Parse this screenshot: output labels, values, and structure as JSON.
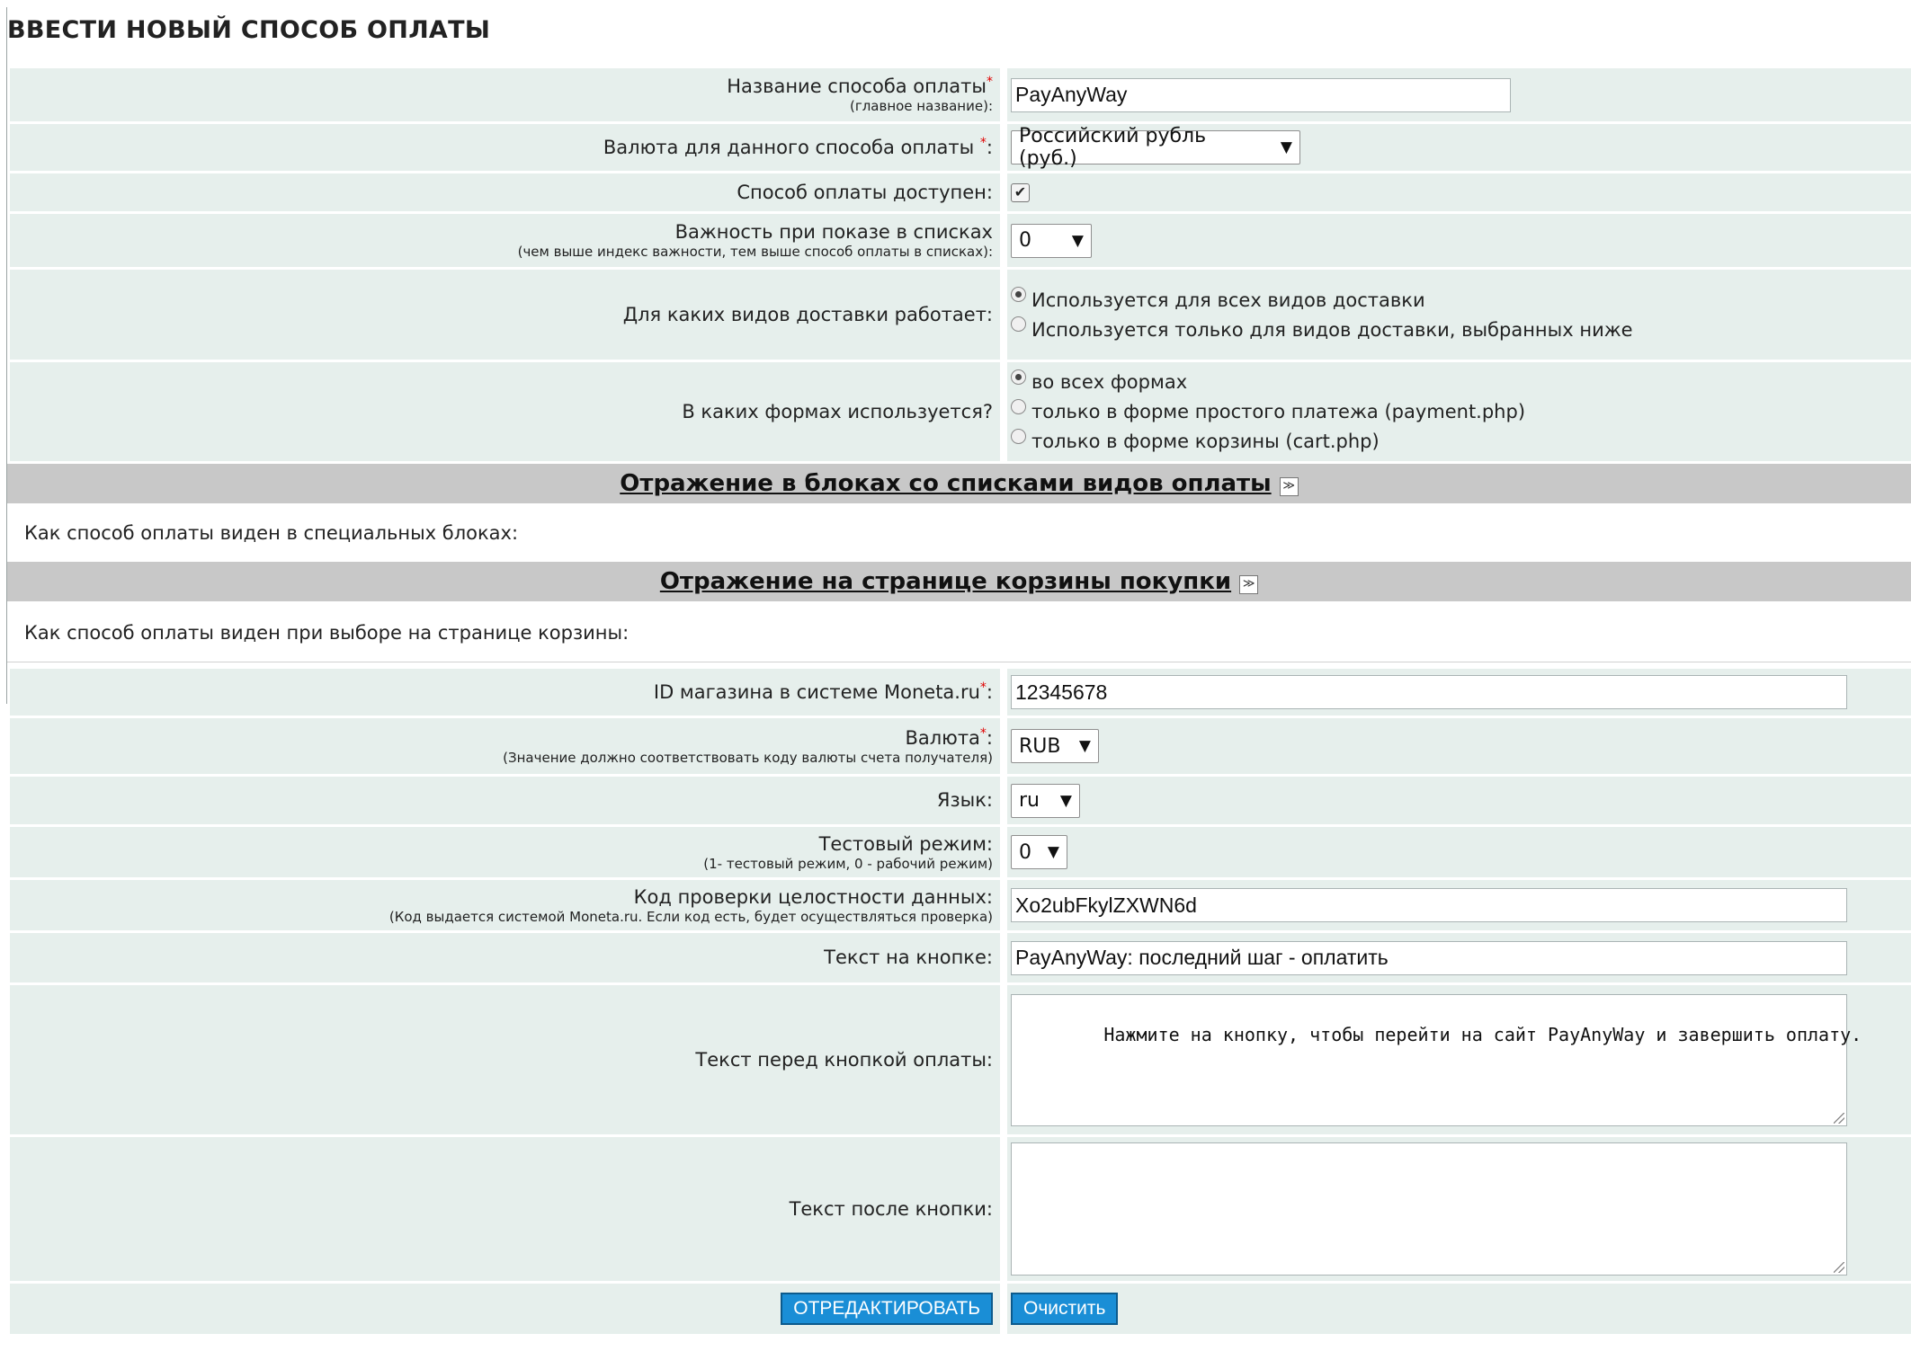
{
  "title": "ВВЕСТИ НОВЫЙ СПОСОБ ОПЛАТЫ",
  "form": {
    "name": {
      "label": "Название способа оплаты",
      "sub": "(главное название):",
      "value": "PayAnyWay"
    },
    "currency": {
      "label": "Валюта для данного способа оплаты",
      "suffix": ":",
      "selected": "Российский рубль (руб.)"
    },
    "available": {
      "label": "Способ оплаты доступен:",
      "checked": true
    },
    "importance": {
      "label": "Важность при показе в списках",
      "sub": "(чем выше индекс важности, тем выше способ оплаты в списках):",
      "selected": "0"
    },
    "delivery": {
      "label": "Для каких видов доставки работает:",
      "options": [
        {
          "label": "Используется для всех видов доставки",
          "checked": true
        },
        {
          "label": "Используется только для видов доставки, выбранных ниже",
          "checked": false
        }
      ]
    },
    "forms": {
      "label": "В каких формах используется?",
      "options": [
        {
          "label": "во всех формах",
          "checked": true
        },
        {
          "label": "только в форме простого платежа (payment.php)",
          "checked": false
        },
        {
          "label": "только в форме корзины (cart.php)",
          "checked": false
        }
      ]
    }
  },
  "sections": {
    "blocks": {
      "title": "Отражение в блоках со списками видов оплаты",
      "note": "Как способ оплаты виден в специальных блоках:"
    },
    "cart": {
      "title": "Отражение на странице корзины покупки",
      "note": "Как способ оплаты виден при выборе на странице корзины:"
    }
  },
  "moneta": {
    "shop_id": {
      "label": "ID магазина в системе Moneta.ru",
      "suffix": ":",
      "value": "12345678"
    },
    "currency": {
      "label": "Валюта",
      "suffix": ":",
      "sub": "(Значение должно соответствовать коду валюты счета получателя)",
      "selected": "RUB"
    },
    "language": {
      "label": "Язык:",
      "selected": "ru"
    },
    "test_mode": {
      "label": "Тестовый режим:",
      "sub": "(1- тестовый режим, 0 - рабочий режим)",
      "selected": "0"
    },
    "integrity": {
      "label": "Код проверки целостности данных:",
      "sub": "(Код выдается системой Moneta.ru. Если код есть, будет осуществляться проверка)",
      "value": "Xo2ubFkylZXWN6d"
    },
    "button_text": {
      "label": "Текст на кнопке:",
      "value": "PayAnyWay: последний шаг - оплатить"
    },
    "text_before": {
      "label": "Текст перед кнопкой оплаты:",
      "value": "Нажмите на кнопку, чтобы перейти на сайт PayAnyWay и завершить оплату."
    },
    "text_after": {
      "label": "Текст после кнопки:",
      "value": ""
    }
  },
  "buttons": {
    "submit": "ОТРЕДАКТИРОВАТЬ",
    "clear": "Очистить"
  },
  "colors": {
    "row_bg": "#e6efec",
    "section_bar": "#c8c8c8",
    "button_bg": "#1a8ed6",
    "required_star": "#e00000"
  }
}
